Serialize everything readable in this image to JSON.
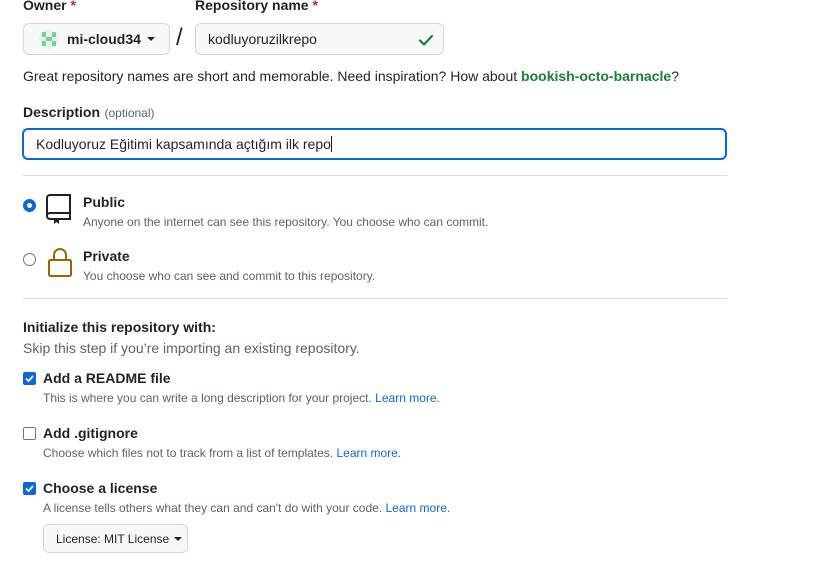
{
  "owner": {
    "label": "Owner",
    "required_mark": "*",
    "value": "mi-cloud34"
  },
  "separator": "/",
  "repo_name": {
    "label": "Repository name",
    "required_mark": "*",
    "value": "kodluyoruzilkrepo",
    "valid": true
  },
  "name_hint": {
    "text": "Great repository names are short and memorable. Need inspiration? How about ",
    "suggestion": "bookish-octo-barnacle",
    "end": "?"
  },
  "description": {
    "label": "Description",
    "optional": "(optional)",
    "value": "Kodluyoruz Eğitimi kapsamında açtığım ilk repo"
  },
  "visibility": {
    "selected": "public",
    "options": [
      {
        "id": "public",
        "title": "Public",
        "desc": "Anyone on the internet can see this repository. You choose who can commit.",
        "icon": "repo-icon"
      },
      {
        "id": "private",
        "title": "Private",
        "desc": "You choose who can see and commit to this repository.",
        "icon": "lock-icon"
      }
    ]
  },
  "init": {
    "title": "Initialize this repository with:",
    "subtitle": "Skip this step if you’re importing an existing repository.",
    "options": [
      {
        "title": "Add a README file",
        "desc": "This is where you can write a long description for your project.",
        "link": "Learn more.",
        "checked": true
      },
      {
        "title": "Add .gitignore",
        "desc": "Choose which files not to track from a list of templates.",
        "link": "Learn more.",
        "checked": false
      },
      {
        "title": "Choose a license",
        "desc": "A license tells others what they can and can't do with your code.",
        "link": "Learn more.",
        "checked": true
      }
    ],
    "license_button": "License: MIT License"
  },
  "colors": {
    "accent": "#0969da",
    "success": "#1a7f37",
    "required": "#cf222e"
  }
}
